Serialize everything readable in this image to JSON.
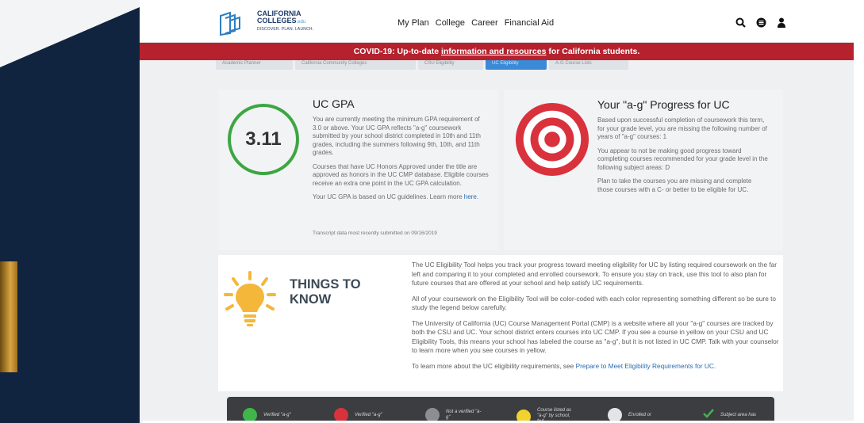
{
  "nav": {
    "logo_line1": "CALIFORNIA",
    "logo_line2": "COLLEGES",
    "logo_edu": ".edu",
    "logo_tagline": "DISCOVER. PLAN. LAUNCH.",
    "links": [
      "My Plan",
      "College",
      "Career",
      "Financial Aid"
    ],
    "icons": [
      "search-icon",
      "menu-icon",
      "user-icon"
    ]
  },
  "banner": {
    "prefix": "COVID-19: Up-to-date ",
    "link": "information and resources",
    "suffix": " for California students."
  },
  "tabs": [
    "Academic Planner",
    "California Community Colleges",
    "CSU Eligibility",
    "UC Eligibility",
    "A-G Course Lists"
  ],
  "gpa_card": {
    "gpa": "3.11",
    "title": "UC GPA",
    "para1": "You are currently meeting the minimum GPA requirement of 3.0 or above. Your UC GPA reflects \"a-g\" coursework submitted by your school district completed in 10th and 11th grades, including the summers following 9th, 10th, and 11th grades.",
    "para2": "Courses that have UC Honors Approved under the title are approved as honors in the UC CMP database. Eligible courses receive an extra one point in the UC GPA calculation.",
    "para3_prefix": "Your UC GPA is based on UC guidelines. Learn more ",
    "para3_link": "here",
    "para3_suffix": ".",
    "transcript": "Transcript data most recently submitted on 09/16/2019",
    "ring_color": "#3da643"
  },
  "progress_card": {
    "title": "Your \"a-g\" Progress for UC",
    "para1": "Based upon successful completion of coursework this term, for your grade level, you are missing the following number of years of \"a-g\" courses: 1",
    "para2": "You appear to not be making good progress toward completing courses recommended for your grade level in the following subject areas: D",
    "para3": "Plan to take the courses you are missing and complete those courses with a C- or better to be eligible for UC.",
    "target_color": "#d9323c"
  },
  "things": {
    "title_line1": "THINGS TO",
    "title_line2": "KNOW",
    "p1": "The UC Eligibility Tool helps you track your progress toward meeting eligibility for UC by listing required coursework on the far left and comparing it to your completed and enrolled coursework. To ensure you stay on track, use this tool to also plan for future courses that are offered at your school and help satisfy UC requirements.",
    "p2": "All of your coursework on the Eligibility Tool will be color-coded with each color representing something different so be sure to study the legend below carefully.",
    "p3": "The University of California (UC) Course Management Portal (CMP) is a website where all your \"a-g\" courses are tracked by both the CSU and UC. Your school district enters courses into UC CMP. If you see a course in yellow on your CSU and UC Eligibility Tools, this means your school has labeled the course as \"a-g\", but it is not listed in UC CMP. Talk with your counselor to learn more when you see courses in yellow.",
    "p4_prefix": "To learn more about the UC eligibility requirements, see ",
    "p4_link": "Prepare to Meet Eligibility Requirements for UC",
    "p4_suffix": "."
  },
  "legend": [
    {
      "label": "Verified \"a-g\"",
      "color": "#3fb54a"
    },
    {
      "label": "Verified \"a-g\"",
      "color": "#d9323c"
    },
    {
      "label": "Not a verified \"a-g\"",
      "color": "#8b8e92"
    },
    {
      "label": "Course listed as \"a-g\" by school, but",
      "color": "#f2d22e"
    },
    {
      "label": "Enrolled or",
      "color": "#e3e4e6"
    },
    {
      "label": "Subject area has",
      "color": "#3fb54a"
    }
  ]
}
